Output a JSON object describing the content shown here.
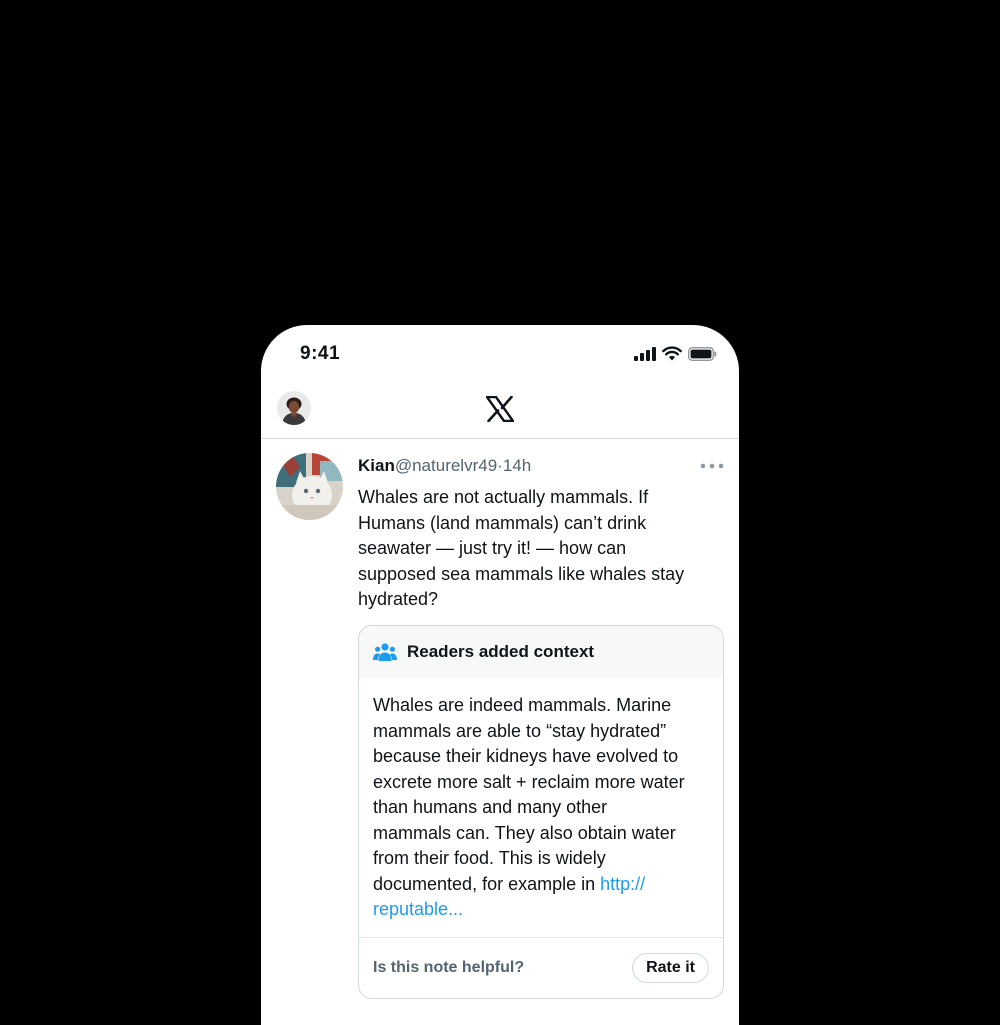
{
  "status_bar": {
    "time": "9:41"
  },
  "nav": {
    "logo_icon": "x-logo-icon"
  },
  "tweet": {
    "author_name": "Kian",
    "author_handle": "@naturelvr49",
    "separator": "·",
    "timestamp": "14h",
    "text_lines": [
      "Whales are not actually mammals. If",
      "Humans (land mammals) can’t drink",
      "seawater — just try it! — how can",
      "supposed sea mammals like whales stay",
      "hydrated?"
    ]
  },
  "note": {
    "title": "Readers added context",
    "icon": "people-icon",
    "body_lines": [
      "Whales are indeed mammals. Marine",
      "mammals are able to “stay hydrated”",
      "because their kidneys have evolved to",
      "excrete more salt + reclaim more water",
      "than humans and many other",
      "mammals can. They also obtain water",
      "from their food. This is widely"
    ],
    "body_line_8_prefix": "documented, for example in ",
    "link_part_1": "http://",
    "link_part_2": "reputable...",
    "helpful_prompt": "Is this note helpful?",
    "rate_label": "Rate it"
  },
  "colors": {
    "background": "#000000",
    "text_primary": "#0f1419",
    "text_secondary": "#536471",
    "link": "#1d9bf0",
    "note_icon": "#1d9bf0",
    "border": "#cfd9de"
  }
}
